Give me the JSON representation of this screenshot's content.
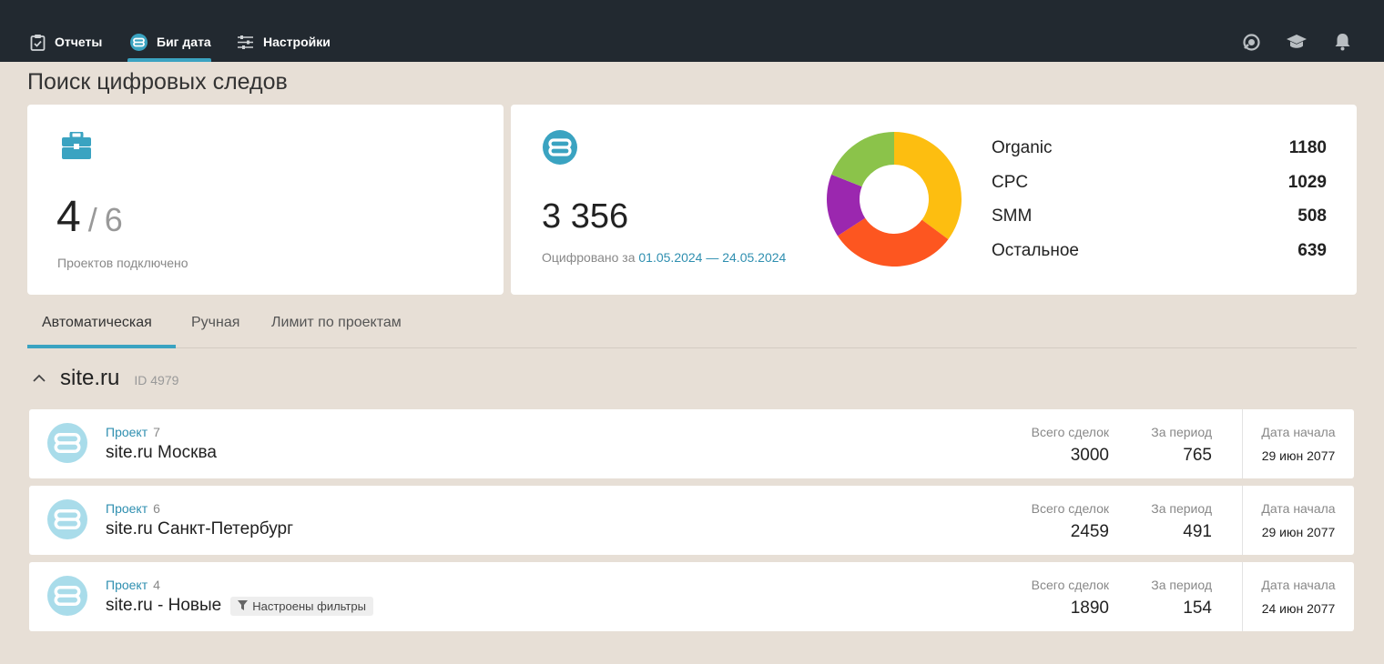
{
  "nav": {
    "items": [
      {
        "label": "Отчеты",
        "icon": "clipboard-icon"
      },
      {
        "label": "Биг дата",
        "icon": "bigdata-icon"
      },
      {
        "label": "Настройки",
        "icon": "sliders-icon"
      }
    ],
    "active_index": 1,
    "right_icons": [
      "support-icon",
      "graduation-cap-icon",
      "bell-icon"
    ]
  },
  "page_title": "Поиск цифровых следов",
  "projects_card": {
    "icon": "briefcase-icon",
    "connected": "4",
    "total": "6",
    "caption": "Проектов подключено"
  },
  "digitized_card": {
    "icon": "bigdata-icon",
    "total": "3 356",
    "caption_prefix": "Оцифровано за",
    "date_range": "01.05.2024 — 24.05.2024"
  },
  "chart_data": {
    "type": "pie",
    "categories": [
      "Organic",
      "CPC",
      "SMM",
      "Остальное"
    ],
    "values": [
      1180,
      1029,
      508,
      639
    ],
    "colors": [
      "#fdbe10",
      "#fd5620",
      "#9b27af",
      "#8bc34a"
    ],
    "title": "",
    "legend_position": "right"
  },
  "tabs": [
    {
      "label": "Автоматическая"
    },
    {
      "label": "Ручная"
    },
    {
      "label": "Лимит по проектам"
    }
  ],
  "group": {
    "title": "site.ru",
    "id_text": "ID 4979"
  },
  "columns": {
    "total_deals": "Всего сделок",
    "period": "За период",
    "start_date": "Дата начала"
  },
  "rows": [
    {
      "project_label": "Проект",
      "project_num": "7",
      "name": "site.ru Москва",
      "badge": "",
      "total": "3000",
      "period": "765",
      "date": "29 июн 2077"
    },
    {
      "project_label": "Проект",
      "project_num": "6",
      "name": "site.ru Санкт-Петербург",
      "badge": "",
      "total": "2459",
      "period": "491",
      "date": "29 июн 2077"
    },
    {
      "project_label": "Проект",
      "project_num": "4",
      "name": "site.ru - Новые",
      "badge": "Настроены фильтры",
      "total": "1890",
      "period": "154",
      "date": "24 июн 2077"
    }
  ],
  "colors": {
    "accent": "#3aa3c1",
    "topbar": "#222930",
    "background": "#e7dfd6"
  }
}
